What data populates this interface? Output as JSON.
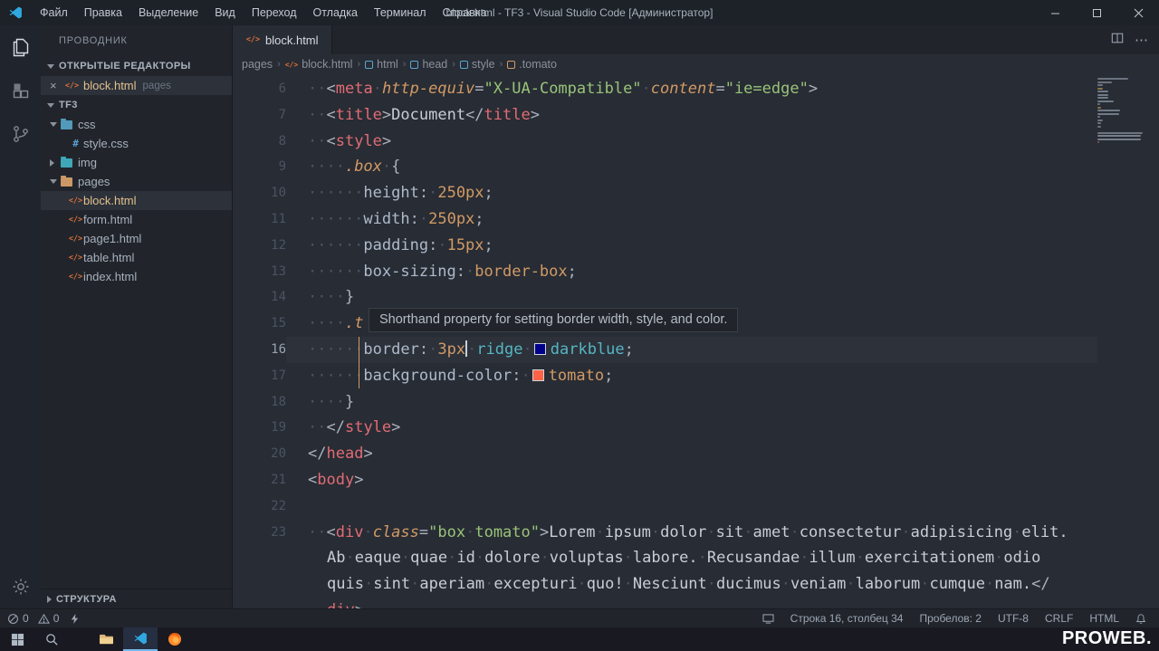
{
  "window": {
    "title": "block.html - TF3 - Visual Studio Code [Администратор]"
  },
  "menu": {
    "items": [
      "Файл",
      "Правка",
      "Выделение",
      "Вид",
      "Переход",
      "Отладка",
      "Терминал",
      "Справка"
    ]
  },
  "activity": {
    "icons": [
      "explorer",
      "extensions",
      "source-control"
    ],
    "bottom": [
      "settings-gear"
    ]
  },
  "sidebar": {
    "title": "ПРОВОДНИК",
    "open_editors": {
      "label": "ОТКРЫТЫЕ РЕДАКТОРЫ",
      "items": [
        {
          "close": "×",
          "name": "block.html",
          "detail": "pages",
          "icon": "html"
        }
      ]
    },
    "workspace": "TF3",
    "tree": [
      {
        "label": "css",
        "type": "folder",
        "color": "#519aba",
        "expanded": true,
        "indent": 1
      },
      {
        "label": "style.css",
        "type": "css",
        "indent": 2
      },
      {
        "label": "img",
        "type": "folder",
        "color": "#3fa7b8",
        "expanded": false,
        "indent": 1
      },
      {
        "label": "pages",
        "type": "folder",
        "color": "#cc9866",
        "expanded": true,
        "indent": 1
      },
      {
        "label": "block.html",
        "type": "html",
        "indent": 2,
        "selected": true
      },
      {
        "label": "form.html",
        "type": "html",
        "indent": 2
      },
      {
        "label": "page1.html",
        "type": "html",
        "indent": 2
      },
      {
        "label": "table.html",
        "type": "html",
        "indent": 2
      },
      {
        "label": "index.html",
        "type": "html",
        "indent": 2
      }
    ],
    "outline": "СТРУКТУРА"
  },
  "editor": {
    "tab": {
      "label": "block.html",
      "icon": "html"
    },
    "actions": {
      "more": "⋯"
    },
    "breadcrumbs": [
      {
        "label": "pages",
        "icon": ""
      },
      {
        "label": "block.html",
        "icon": "file-html"
      },
      {
        "label": "html",
        "icon": "symbol-tag"
      },
      {
        "label": "head",
        "icon": "symbol-tag"
      },
      {
        "label": "style",
        "icon": "symbol-tag"
      },
      {
        "label": ".tomato",
        "icon": "symbol-class"
      }
    ],
    "tooltip": "Shorthand property for setting border width, style, and color.",
    "lines": [
      {
        "num": "6",
        "tokens": [
          [
            "ws",
            "  "
          ],
          [
            "p",
            "<"
          ],
          [
            "t",
            "meta"
          ],
          [
            "ws",
            " "
          ],
          [
            "a",
            "http-equiv"
          ],
          [
            "p",
            "="
          ],
          [
            "s",
            "\"X-UA-Compatible\""
          ],
          [
            "ws",
            " "
          ],
          [
            "a",
            "content"
          ],
          [
            "p",
            "="
          ],
          [
            "s",
            "\"ie=edge\""
          ],
          [
            "p",
            ">"
          ]
        ]
      },
      {
        "num": "7",
        "tokens": [
          [
            "ws",
            "  "
          ],
          [
            "p",
            "<"
          ],
          [
            "t",
            "title"
          ],
          [
            "p",
            ">"
          ],
          [
            "x",
            "Document"
          ],
          [
            "p",
            "</"
          ],
          [
            "t",
            "title"
          ],
          [
            "p",
            ">"
          ]
        ]
      },
      {
        "num": "8",
        "tokens": [
          [
            "ws",
            "  "
          ],
          [
            "p",
            "<"
          ],
          [
            "t",
            "style"
          ],
          [
            "p",
            ">"
          ]
        ]
      },
      {
        "num": "9",
        "tokens": [
          [
            "ws",
            "    "
          ],
          [
            "sel",
            ".box"
          ],
          [
            "ws",
            " "
          ],
          [
            "p",
            "{"
          ]
        ]
      },
      {
        "num": "10",
        "tokens": [
          [
            "ws",
            "      "
          ],
          [
            "pr",
            "height"
          ],
          [
            "p",
            ":"
          ],
          [
            "ws",
            " "
          ],
          [
            "num",
            "250px"
          ],
          [
            "p",
            ";"
          ]
        ]
      },
      {
        "num": "11",
        "tokens": [
          [
            "ws",
            "      "
          ],
          [
            "pr",
            "width"
          ],
          [
            "p",
            ":"
          ],
          [
            "ws",
            " "
          ],
          [
            "num",
            "250px"
          ],
          [
            "p",
            ";"
          ]
        ]
      },
      {
        "num": "12",
        "tokens": [
          [
            "ws",
            "      "
          ],
          [
            "pr",
            "padding"
          ],
          [
            "p",
            ":"
          ],
          [
            "ws",
            " "
          ],
          [
            "num",
            "15px"
          ],
          [
            "p",
            ";"
          ]
        ]
      },
      {
        "num": "13",
        "tokens": [
          [
            "ws",
            "      "
          ],
          [
            "pr",
            "box-sizing"
          ],
          [
            "p",
            ":"
          ],
          [
            "ws",
            " "
          ],
          [
            "num",
            "border-box"
          ],
          [
            "p",
            ";"
          ]
        ]
      },
      {
        "num": "14",
        "tokens": [
          [
            "ws",
            "    "
          ],
          [
            "p",
            "}"
          ]
        ]
      },
      {
        "num": "15",
        "tokens": [
          [
            "ws",
            "    "
          ],
          [
            "sel",
            ".t"
          ]
        ]
      },
      {
        "num": "16",
        "current": true,
        "tokens": [
          [
            "ws",
            "      "
          ],
          [
            "pr",
            "border"
          ],
          [
            "p",
            ":"
          ],
          [
            "ws",
            " "
          ],
          [
            "num",
            "3px"
          ],
          [
            "cur",
            ""
          ],
          [
            "ws",
            " "
          ],
          [
            "kw",
            "ridge"
          ],
          [
            "ws",
            " "
          ],
          [
            "sw",
            "#00008b"
          ],
          [
            "kw",
            "darkblue"
          ],
          [
            "p",
            ";"
          ]
        ]
      },
      {
        "num": "17",
        "tokens": [
          [
            "ws",
            "      "
          ],
          [
            "pr",
            "background-color"
          ],
          [
            "p",
            ":"
          ],
          [
            "ws",
            " "
          ],
          [
            "sw",
            "#ff6347"
          ],
          [
            "num",
            "tomato"
          ],
          [
            "p",
            ";"
          ]
        ]
      },
      {
        "num": "18",
        "tokens": [
          [
            "ws",
            "    "
          ],
          [
            "p",
            "}"
          ]
        ]
      },
      {
        "num": "19",
        "tokens": [
          [
            "ws",
            "  "
          ],
          [
            "p",
            "</"
          ],
          [
            "t",
            "style"
          ],
          [
            "p",
            ">"
          ]
        ]
      },
      {
        "num": "20",
        "tokens": [
          [
            "p",
            "</"
          ],
          [
            "t",
            "head"
          ],
          [
            "p",
            ">"
          ]
        ]
      },
      {
        "num": "21",
        "tokens": [
          [
            "p",
            "<"
          ],
          [
            "t",
            "body"
          ],
          [
            "p",
            ">"
          ]
        ]
      },
      {
        "num": "22",
        "tokens": []
      },
      {
        "num": "23",
        "tokens": [
          [
            "ws",
            "  "
          ],
          [
            "p",
            "<"
          ],
          [
            "t",
            "div"
          ],
          [
            "ws",
            " "
          ],
          [
            "a",
            "class"
          ],
          [
            "p",
            "="
          ],
          [
            "s",
            "\"box tomato\""
          ],
          [
            "p",
            ">"
          ],
          [
            "x",
            "Lorem ipsum dolor sit amet consectetur adipisicing elit."
          ]
        ]
      },
      {
        "num": "",
        "tokens": [
          [
            "x",
            "Ab eaque quae id dolore voluptas labore. Recusandae illum exercitationem odio"
          ]
        ]
      },
      {
        "num": "",
        "tokens": [
          [
            "x",
            "quis sint aperiam excepturi quo! Nesciunt ducimus veniam laborum cumque nam."
          ],
          [
            "p",
            "</"
          ]
        ]
      },
      {
        "num": "",
        "tokens": [
          [
            "t",
            "div"
          ],
          [
            "p",
            ">"
          ]
        ]
      }
    ]
  },
  "status_bar": {
    "errors": "0",
    "warnings": "0",
    "line_col": "Строка 16, столбец 34",
    "spaces": "Пробелов: 2",
    "encoding": "UTF-8",
    "eol": "CRLF",
    "language": "HTML"
  },
  "taskbar": {
    "apps": [
      "start",
      "search",
      "file-explorer",
      "vscode",
      "firefox"
    ]
  },
  "watermark": "PROWEB."
}
